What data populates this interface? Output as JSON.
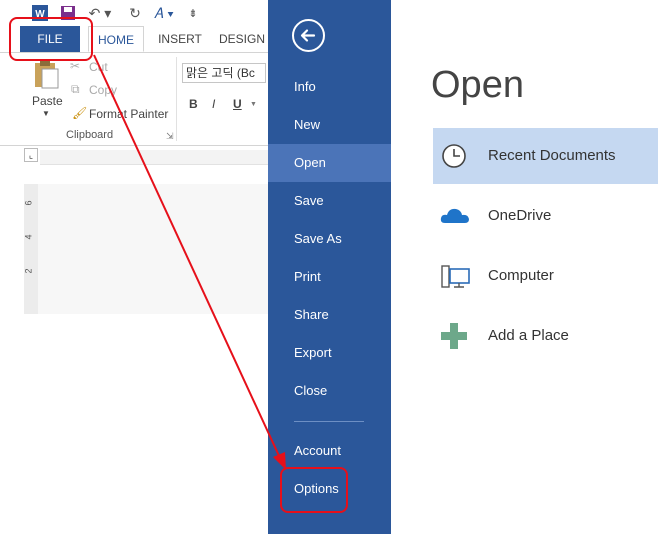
{
  "tabs": {
    "file": "FILE",
    "home": "HOME",
    "insert": "INSERT",
    "design": "DESIGN"
  },
  "ribbon": {
    "paste": "Paste",
    "cut": "Cut",
    "copy": "Copy",
    "format_painter": "Format Painter",
    "clipboard": "Clipboard",
    "font_name": "맑은 고딕 (Bc",
    "bold": "B",
    "italic": "I",
    "underline": "U"
  },
  "ruler": {
    "marks": [
      "6",
      "4",
      "2"
    ]
  },
  "nav": {
    "items": [
      "Info",
      "New",
      "Open",
      "Save",
      "Save As",
      "Print",
      "Share",
      "Export",
      "Close"
    ],
    "account": "Account",
    "options": "Options",
    "selected": "Open"
  },
  "main": {
    "title": "Open",
    "places": [
      {
        "label": "Recent Documents",
        "icon": "clock-icon"
      },
      {
        "label": "OneDrive",
        "icon": "cloud-icon"
      },
      {
        "label": "Computer",
        "icon": "computer-icon"
      },
      {
        "label": "Add a Place",
        "icon": "plus-icon"
      }
    ]
  },
  "colors": {
    "word_blue": "#2b579a",
    "nav_selected": "#4b74b8",
    "place_selected": "#c5d8f1",
    "annotation_red": "#e6101a"
  }
}
